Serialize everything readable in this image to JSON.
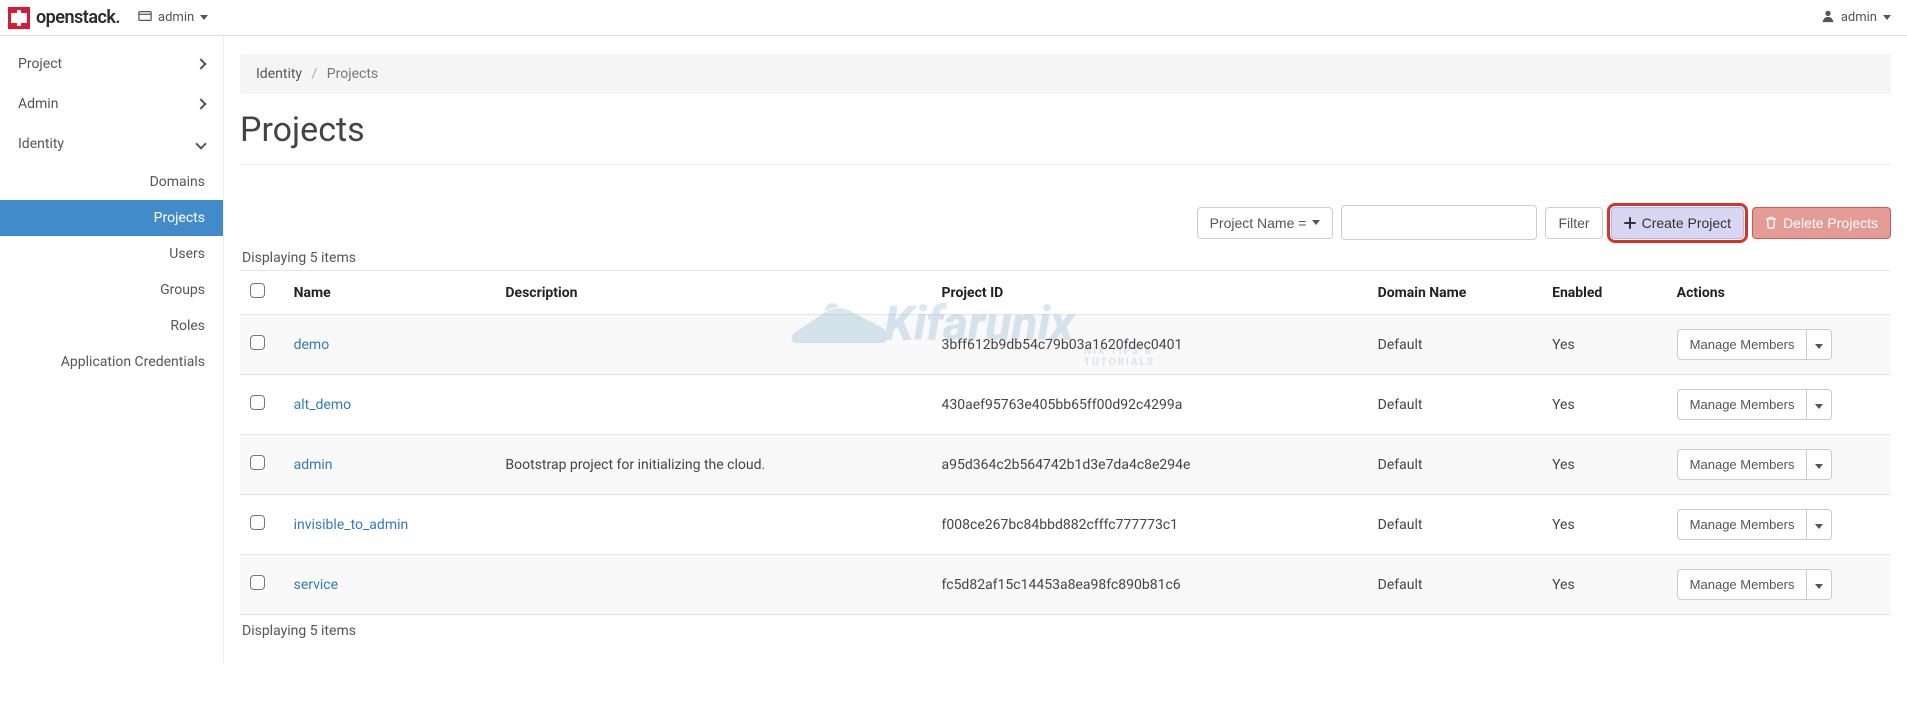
{
  "brand": {
    "name": "openstack."
  },
  "topnav": {
    "domain_label": "admin",
    "user_label": "admin"
  },
  "sidebar": {
    "groups": [
      {
        "label": "Project",
        "expanded": false
      },
      {
        "label": "Admin",
        "expanded": false
      },
      {
        "label": "Identity",
        "expanded": true
      }
    ],
    "identity_items": [
      {
        "label": "Domains",
        "active": false
      },
      {
        "label": "Projects",
        "active": true
      },
      {
        "label": "Users",
        "active": false
      },
      {
        "label": "Groups",
        "active": false
      },
      {
        "label": "Roles",
        "active": false
      },
      {
        "label": "Application Credentials",
        "active": false
      }
    ]
  },
  "breadcrumb": {
    "parent": "Identity",
    "current": "Projects"
  },
  "page_title": "Projects",
  "toolbar": {
    "filter_field_label": "Project Name =",
    "search_placeholder": "",
    "filter_button": "Filter",
    "create_button": "Create Project",
    "delete_button": "Delete Projects"
  },
  "table": {
    "displaying_top": "Displaying 5 items",
    "displaying_bottom": "Displaying 5 items",
    "headers": {
      "name": "Name",
      "description": "Description",
      "project_id": "Project ID",
      "domain_name": "Domain Name",
      "enabled": "Enabled",
      "actions": "Actions"
    },
    "action_button_label": "Manage Members",
    "rows": [
      {
        "name": "demo",
        "description": "",
        "project_id": "3bff612b9db54c79b03a1620fdec0401",
        "domain_name": "Default",
        "enabled": "Yes"
      },
      {
        "name": "alt_demo",
        "description": "",
        "project_id": "430aef95763e405bb65ff00d92c4299a",
        "domain_name": "Default",
        "enabled": "Yes"
      },
      {
        "name": "admin",
        "description": "Bootstrap project for initializing the cloud.",
        "project_id": "a95d364c2b564742b1d3e7da4c8e294e",
        "domain_name": "Default",
        "enabled": "Yes"
      },
      {
        "name": "invisible_to_admin",
        "description": "",
        "project_id": "f008ce267bc84bbd882cfffc777773c1",
        "domain_name": "Default",
        "enabled": "Yes"
      },
      {
        "name": "service",
        "description": "",
        "project_id": "fc5d82af15c14453a8ea98fc890b81c6",
        "domain_name": "Default",
        "enabled": "Yes"
      }
    ]
  },
  "watermark": {
    "text": "Kifarunix",
    "sub": "NIX TIPS & TUTORIALS"
  }
}
